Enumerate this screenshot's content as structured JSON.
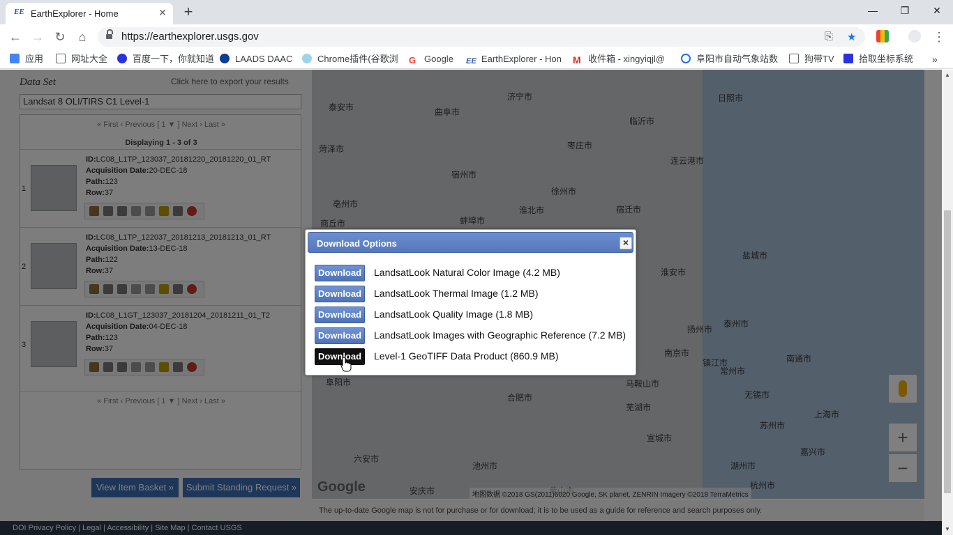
{
  "browser": {
    "tab_favicon": "EE",
    "tab_title": "EarthExplorer - Home",
    "url": "https://earthexplorer.usgs.gov",
    "bookmarks": [
      {
        "label": "应用",
        "color": "#4285f4"
      },
      {
        "label": "网址大全",
        "color": "#ffffff"
      },
      {
        "label": "百度一下，你就知道",
        "color": "#2932e1"
      },
      {
        "label": "LAADS DAAC",
        "color": "#0b3d91"
      },
      {
        "label": "Chrome插件(谷歌浏",
        "color": "#9fd3e8"
      },
      {
        "label": "Google",
        "color": "#ea4335"
      },
      {
        "label": "EarthExplorer - Hon",
        "color": "#2b5a99"
      },
      {
        "label": "收件箱 - xingyiqjl@",
        "color": "#d93025"
      },
      {
        "label": "阜阳市自动气象站数",
        "color": "#1a73e8"
      },
      {
        "label": "狗带TV",
        "color": "#ffffff"
      },
      {
        "label": "拾取坐标系统",
        "color": "#2932e1"
      }
    ]
  },
  "left_panel": {
    "dataset_label": "Data Set",
    "export_link": "Click here to export your results",
    "dataset_value": "Landsat 8 OLI/TIRS C1 Level-1",
    "pager_top": "« First ‹ Previous [ 1 ▼ ] Next › Last »",
    "displaying": "Displaying 1 - 3 of 3",
    "results": [
      {
        "num": "1",
        "id": "LC08_L1TP_123037_20181220_20181220_01_RT",
        "date": "20-DEC-18",
        "path": "123",
        "row": "37"
      },
      {
        "num": "2",
        "id": "LC08_L1TP_122037_20181213_20181213_01_RT",
        "date": "13-DEC-18",
        "path": "122",
        "row": "37"
      },
      {
        "num": "3",
        "id": "LC08_L1GT_123037_20181204_20181211_01_T2",
        "date": "04-DEC-18",
        "path": "123",
        "row": "37"
      }
    ],
    "labels": {
      "id": "ID:",
      "date": "Acquisition Date:",
      "path": "Path:",
      "row": "Row:"
    },
    "pager_bottom": "« First ‹ Previous [ 1 ▼ ] Next › Last »",
    "view_basket": "View Item Basket »",
    "submit_standing": "Submit Standing Request »"
  },
  "map": {
    "cities": [
      "济宁市",
      "日照市",
      "曲阜市",
      "泰安市",
      "临沂市",
      "枣庄市",
      "连云港市",
      "菏泽市",
      "徐州市",
      "宿迁市",
      "淮北市",
      "宿州市",
      "盐城市",
      "淮安市",
      "扬州市",
      "泰州市",
      "南通市",
      "南京市",
      "常州市",
      "无锡市",
      "苏州市",
      "上海市",
      "镇江市",
      "马鞍山市",
      "芜湖市",
      "宣城市",
      "湖州市",
      "嘉兴市",
      "杭州市",
      "黄山市",
      "池州市",
      "安庆市",
      "六安市",
      "亳州市",
      "商丘市",
      "阜阳市",
      "蚌埠市",
      "合肥市"
    ],
    "google_logo": "Google",
    "attribution": "地图数据 ©2018 GS(2011)6020 Google, SK planet, ZENRIN Imagery ©2018 TerraMetrics",
    "zoom_in": "+",
    "zoom_out": "−",
    "disclaimer": "The up-to-date Google map is not for purchase or for download; it is to be used as a guide for reference and search purposes only."
  },
  "footer": "DOI Privacy Policy | Legal | Accessibility | Site Map | Contact USGS",
  "modal": {
    "title": "Download Options",
    "close": "×",
    "button_label": "Download",
    "options": [
      {
        "label": "LandsatLook Natural Color Image (4.2 MB)"
      },
      {
        "label": "LandsatLook Thermal Image (1.2 MB)"
      },
      {
        "label": "LandsatLook Quality Image (1.8 MB)"
      },
      {
        "label": "LandsatLook Images with Geographic Reference (7.2 MB)"
      },
      {
        "label": "Level-1 GeoTIFF Data Product (860.9 MB)"
      }
    ]
  }
}
